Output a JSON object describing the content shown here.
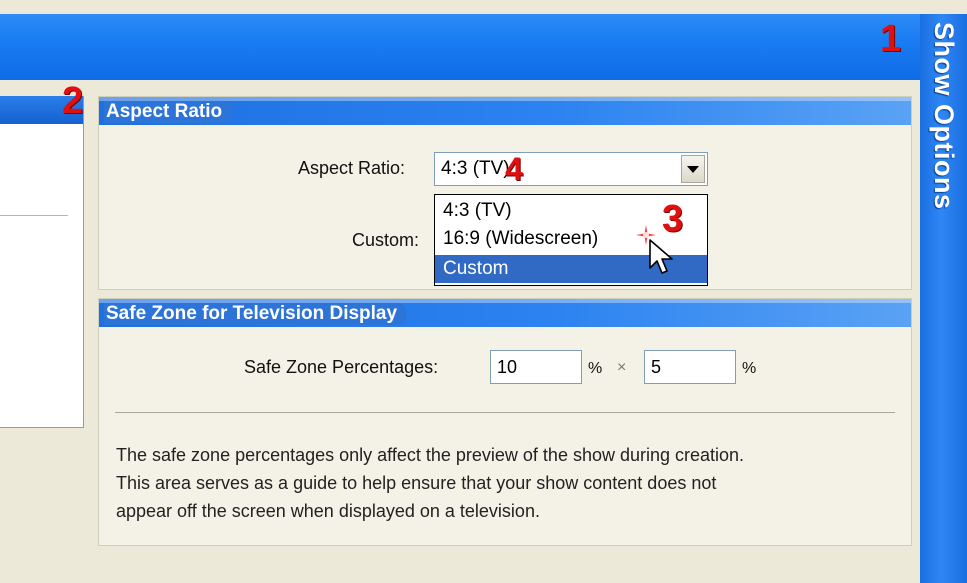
{
  "header": {
    "side_tab_label": "Show Options"
  },
  "callouts": {
    "one": "1",
    "two": "2",
    "three": "3",
    "four": "4"
  },
  "aspect_ratio_group": {
    "title": "Aspect Ratio",
    "aspect_ratio_label": "Aspect Ratio:",
    "selected_value": "4:3 (TV)",
    "custom_label": "Custom:",
    "options": [
      "4:3 (TV)",
      "16:9 (Widescreen)",
      "Custom"
    ],
    "highlighted_option": "Custom"
  },
  "safe_zone_group": {
    "title": "Safe Zone for Television Display",
    "percentages_label": "Safe Zone Percentages:",
    "horizontal_value": "10",
    "horizontal_unit": "%",
    "times_symbol": "×",
    "vertical_value": "5",
    "vertical_unit": "%",
    "description_lines": [
      "The safe zone percentages only affect the preview of the show during creation.",
      "This area serves as a guide to help ensure that your show content does not",
      "appear off the screen when displayed on a television."
    ]
  },
  "colors": {
    "title_bar_blue": "#1a7cf2",
    "callout_red": "#e01010",
    "selection_blue": "#316ac5",
    "panel_beige": "#f4f2e6"
  },
  "icons": {
    "dropdown": "chevron-down-icon",
    "pointer": "mouse-pointer-icon",
    "click_highlight": "click-sparkle-icon"
  }
}
